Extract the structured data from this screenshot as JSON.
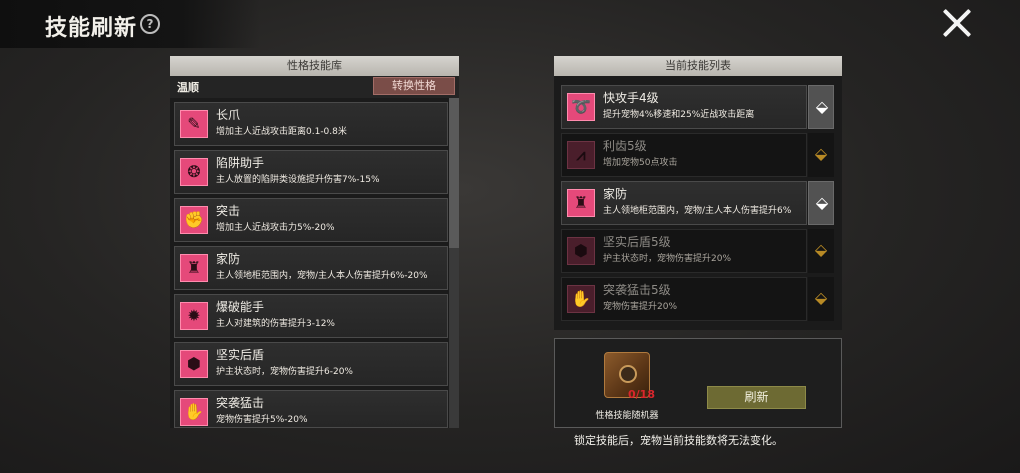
{
  "header": {
    "title": "技能刷新",
    "help": "?"
  },
  "library": {
    "header": "性格技能库",
    "trait": "温顺",
    "swap_label": "转换性格",
    "items": [
      {
        "name": "长爪",
        "desc": "增加主人近战攻击距离0.1-0.8米",
        "icon": "claw-icon"
      },
      {
        "name": "陷阱助手",
        "desc": "主人放置的陷阱类设施提升伤害7%-15%",
        "icon": "trap-icon"
      },
      {
        "name": "突击",
        "desc": "增加主人近战攻击力5%-20%",
        "icon": "assault-icon"
      },
      {
        "name": "家防",
        "desc": "主人领地柜范围内，宠物/主人本人伤害提升6%-20%",
        "icon": "home-defense-icon"
      },
      {
        "name": "爆破能手",
        "desc": "主人对建筑的伤害提升3-12%",
        "icon": "bomb-icon"
      },
      {
        "name": "坚实后盾",
        "desc": "护主状态时，宠物伤害提升6-20%",
        "icon": "shield-icon"
      },
      {
        "name": "突袭猛击",
        "desc": "宠物伤害提升5%-20%",
        "icon": "paw-icon"
      }
    ]
  },
  "current": {
    "header": "当前技能列表",
    "items": [
      {
        "name": "快攻手4级",
        "desc": "提升宠物4%移速和25%近战攻击距离",
        "icon": "fast-attack-icon",
        "active": true
      },
      {
        "name": "利齿5级",
        "desc": "增加宠物50点攻击",
        "icon": "teeth-icon",
        "active": false
      },
      {
        "name": "家防",
        "desc": "主人领地柜范围内，宠物/主人本人伤害提升6%",
        "icon": "home-defense-icon",
        "active": true
      },
      {
        "name": "坚实后盾5级",
        "desc": "护主状态时，宠物伤害提升20%",
        "icon": "shield-icon",
        "active": false
      },
      {
        "name": "突袭猛击5级",
        "desc": "宠物伤害提升20%",
        "icon": "paw-icon",
        "active": false
      }
    ]
  },
  "refresher": {
    "count": "0/18",
    "device_label": "性格技能随机器",
    "button_label": "刷新"
  },
  "note": "锁定技能后，宠物当前技能数将无法变化。",
  "colors": {
    "skill_pink": "#e5497a",
    "lock_gold": "#b88a25",
    "refresh_olive": "#6d6a33",
    "count_red": "#d9262c"
  }
}
